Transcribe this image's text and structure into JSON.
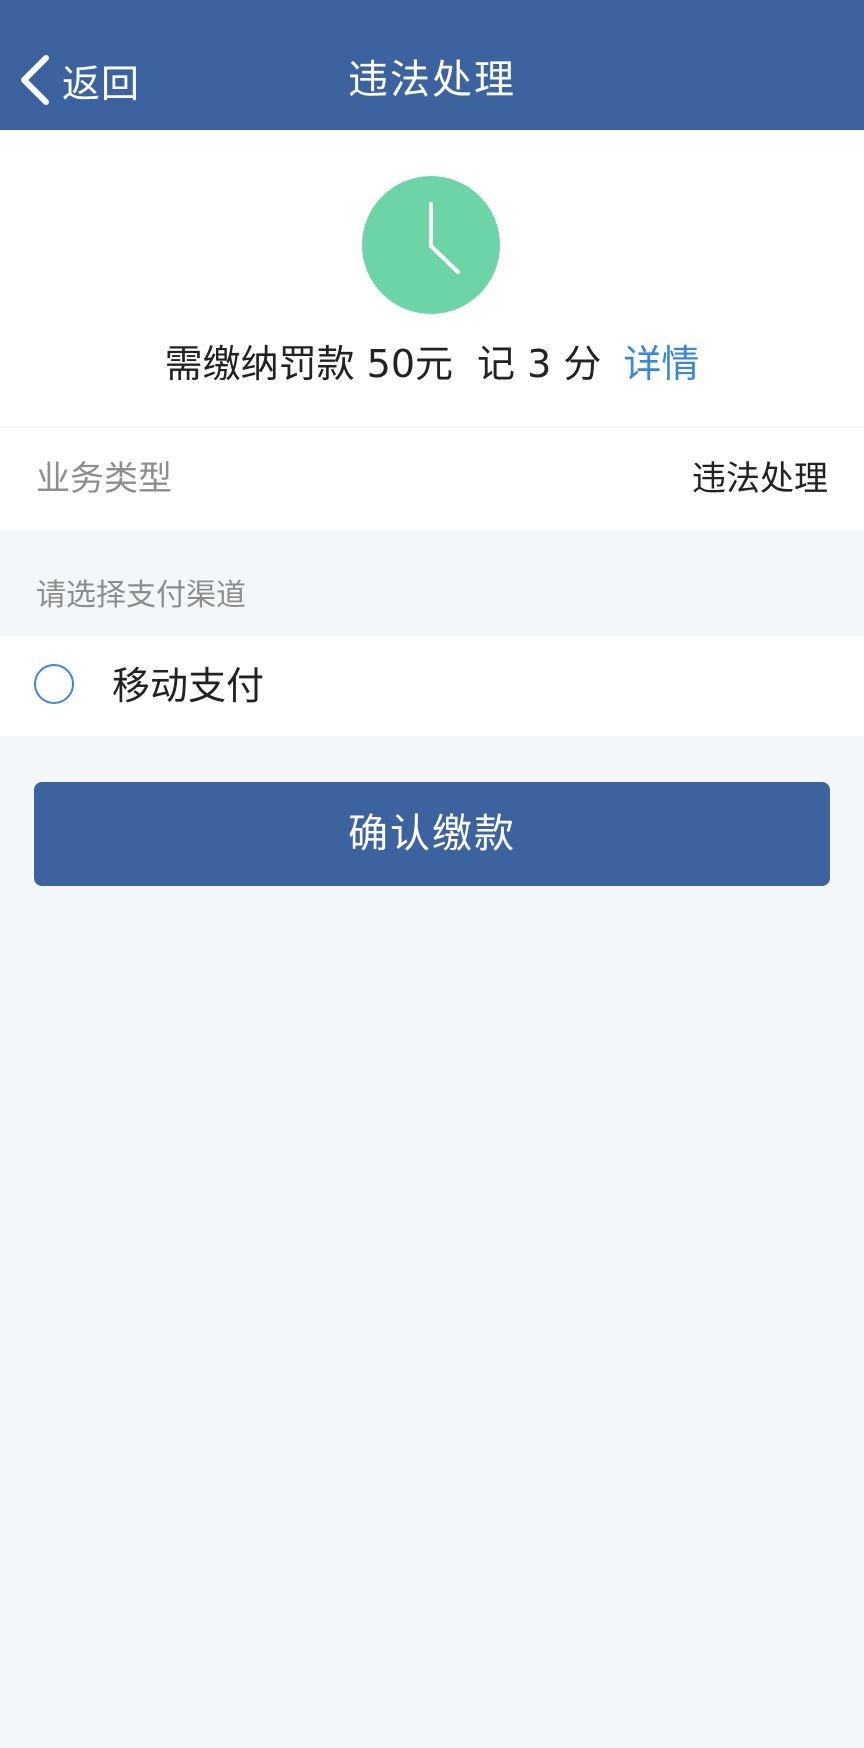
{
  "nav": {
    "back_label": "返回",
    "title": "违法处理"
  },
  "summary": {
    "status_icon": "clock-icon",
    "fine_text": "需缴纳罚款 50元",
    "points_text": "记 3 分",
    "details_link": "详情"
  },
  "business": {
    "label": "业务类型",
    "value": "违法处理"
  },
  "payment": {
    "section_title": "请选择支付渠道",
    "options": [
      {
        "label": "移动支付",
        "selected": false
      }
    ]
  },
  "actions": {
    "confirm_label": "确认缴款"
  },
  "colors": {
    "nav_background": "#3c63a0",
    "clock_green": "#6dd4a8",
    "link_blue": "#3c86d6",
    "page_background": "#f3f7f9"
  }
}
